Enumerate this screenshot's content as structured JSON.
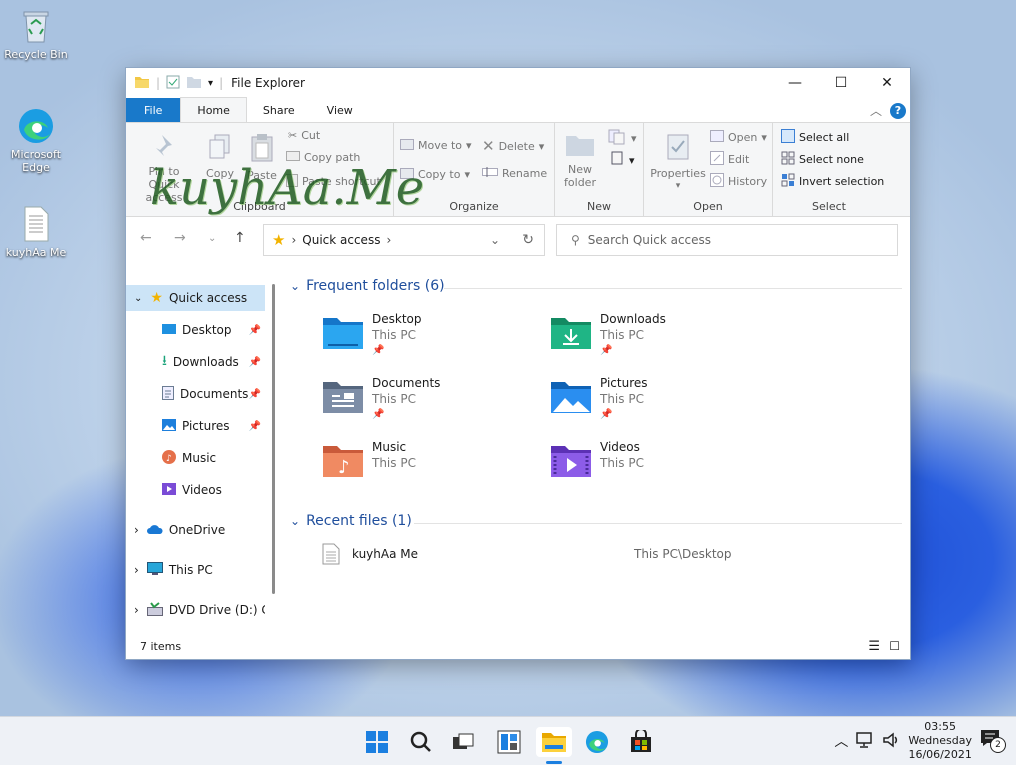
{
  "desktop": {
    "icons": [
      {
        "label": "Recycle Bin",
        "icon": "recycle-bin-icon"
      },
      {
        "label": "Microsoft Edge",
        "icon": "edge-icon"
      },
      {
        "label": "kuyhAa Me",
        "icon": "text-file-icon"
      }
    ]
  },
  "window": {
    "title": "File Explorer",
    "tabs": [
      "File",
      "Home",
      "Share",
      "View"
    ],
    "active_tab": "Home",
    "ribbon": {
      "clipboard": {
        "pin": "Pin to Quick access",
        "copy": "Copy",
        "paste": "Paste",
        "cut": "Cut",
        "copy_path": "Copy path",
        "paste_shortcut": "Paste shortcut",
        "label": "Clipboard"
      },
      "organize": {
        "move_to": "Move to",
        "copy_to": "Copy to",
        "delete": "Delete",
        "rename": "Rename",
        "label": "Organize"
      },
      "new": {
        "new_folder": "New folder",
        "label": "New"
      },
      "open": {
        "properties": "Properties",
        "open": "Open",
        "edit": "Edit",
        "history": "History",
        "label": "Open"
      },
      "select": {
        "select_all": "Select all",
        "select_none": "Select none",
        "invert": "Invert selection",
        "label": "Select"
      }
    },
    "address": {
      "path": "Quick access",
      "search_placeholder": "Search Quick access"
    },
    "nav": [
      {
        "label": "Quick access",
        "icon": "star-icon",
        "level": 0,
        "selected": true
      },
      {
        "label": "Desktop",
        "icon": "desktop-folder-icon",
        "level": 1,
        "pinned": true
      },
      {
        "label": "Downloads",
        "icon": "download-icon",
        "level": 1,
        "pinned": true
      },
      {
        "label": "Documents",
        "icon": "documents-icon",
        "level": 1,
        "pinned": true
      },
      {
        "label": "Pictures",
        "icon": "pictures-icon",
        "level": 1,
        "pinned": true
      },
      {
        "label": "Music",
        "icon": "music-icon",
        "level": 1
      },
      {
        "label": "Videos",
        "icon": "videos-icon",
        "level": 1
      },
      {
        "label": "OneDrive",
        "icon": "cloud-icon",
        "level": 0
      },
      {
        "label": "This PC",
        "icon": "monitor-icon",
        "level": 0
      },
      {
        "label": "DVD Drive (D:) CC",
        "icon": "dvd-drive-icon",
        "level": 0
      }
    ],
    "frequent": {
      "title": "Frequent folders (6)",
      "folders": [
        {
          "name": "Desktop",
          "location": "This PC",
          "pinned": true,
          "color": "#1e90e0"
        },
        {
          "name": "Downloads",
          "location": "This PC",
          "pinned": true,
          "color": "#1aa37a"
        },
        {
          "name": "Documents",
          "location": "This PC",
          "pinned": true,
          "color": "#6b7c93"
        },
        {
          "name": "Pictures",
          "location": "This PC",
          "pinned": true,
          "color": "#1d7fdc"
        },
        {
          "name": "Music",
          "location": "This PC",
          "pinned": false,
          "color": "#e5704a"
        },
        {
          "name": "Videos",
          "location": "This PC",
          "pinned": false,
          "color": "#7a4bd6"
        }
      ]
    },
    "recent": {
      "title": "Recent files (1)",
      "files": [
        {
          "name": "kuyhAa Me",
          "path": "This PC\\Desktop"
        }
      ]
    },
    "status": {
      "items": "7 items"
    }
  },
  "watermark": {
    "text": "kuyhAa.Me"
  },
  "taskbar": {
    "icons": [
      "windows-start-icon",
      "search-icon",
      "task-view-icon",
      "widgets-icon",
      "file-explorer-icon",
      "edge-icon",
      "store-icon"
    ],
    "time": "03:55",
    "day": "Wednesday",
    "date": "16/06/2021",
    "notifications": "2"
  }
}
